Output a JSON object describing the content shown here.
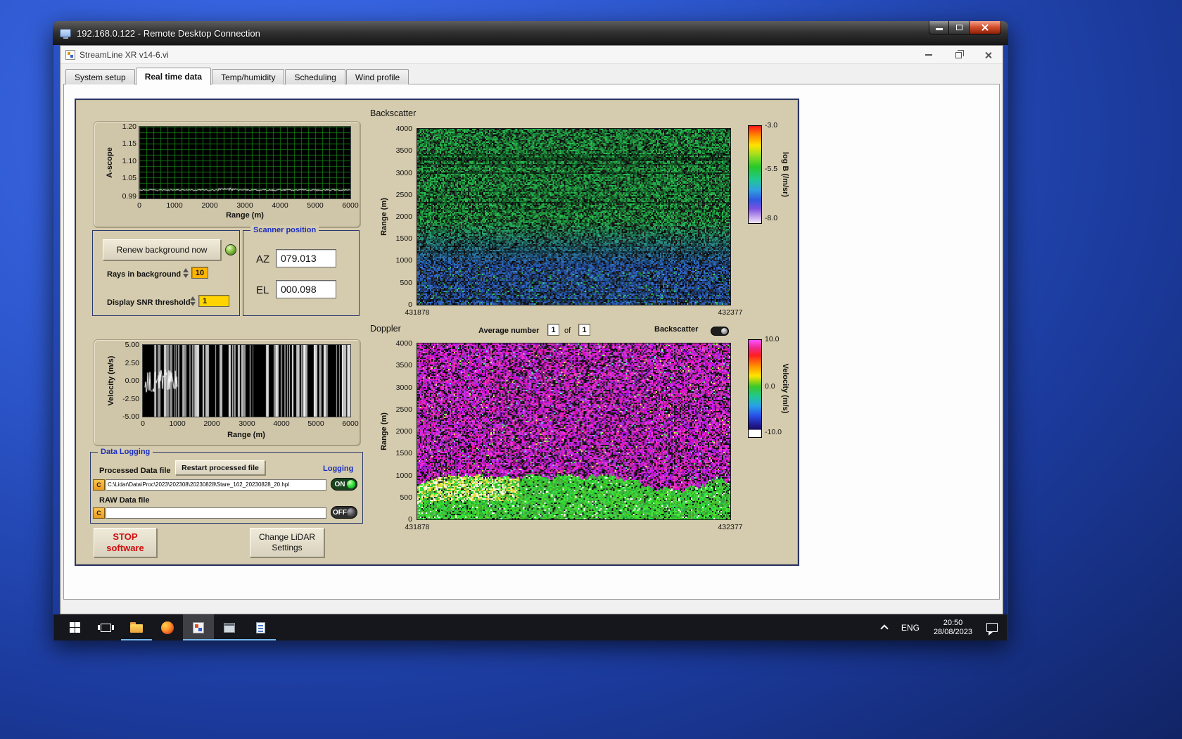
{
  "rdp": {
    "title": "192.168.0.122 - Remote Desktop Connection"
  },
  "app": {
    "title": "StreamLine XR v14-6.vi",
    "tabs": [
      "System setup",
      "Real time data",
      "Temp/humidity",
      "Scheduling",
      "Wind profile"
    ],
    "active_tab": "Real time data"
  },
  "ascope": {
    "ylabel": "A-scope",
    "xlabel": "Range (m)",
    "yticks": [
      "1.20",
      "1.15",
      "1.10",
      "1.05",
      "0.99"
    ],
    "xticks": [
      "0",
      "1000",
      "2000",
      "3000",
      "4000",
      "5000",
      "6000"
    ]
  },
  "background_controls": {
    "renew_button": "Renew background now",
    "rays_label": "Rays in background",
    "rays_value": "10",
    "snr_label": "Display SNR threshold",
    "snr_value": "1"
  },
  "scanner": {
    "title": "Scanner position",
    "az_label": "AZ",
    "az_value": "079.013",
    "el_label": "EL",
    "el_value": "000.098"
  },
  "backscatter": {
    "title": "Backscatter",
    "ylabel": "Range (m)",
    "yticks": [
      "4000",
      "3500",
      "3000",
      "2500",
      "2000",
      "1500",
      "1000",
      "500",
      "0"
    ],
    "x_start": "431878",
    "x_end": "432377",
    "colorbar": {
      "ticks": [
        "-3.0",
        "-5.5",
        "-8.0"
      ],
      "label": "log B (/m/sr)"
    }
  },
  "doppler": {
    "title": "Doppler",
    "average_label": "Average number",
    "average_value": "1",
    "of_label": "of",
    "of_value": "1",
    "backscatter_toggle_label": "Backscatter",
    "ylabel": "Range (m)",
    "yticks": [
      "4000",
      "3500",
      "3000",
      "2500",
      "2000",
      "1500",
      "1000",
      "500",
      "0"
    ],
    "x_start": "431878",
    "x_end": "432377",
    "colorbar": {
      "ticks": [
        "10.0",
        "0.0",
        "-10.0"
      ],
      "label": "Velocity (m/s)"
    }
  },
  "velocity": {
    "ylabel": "Velocity (m/s)",
    "xlabel": "Range (m)",
    "yticks": [
      "5.00",
      "2.50",
      "0.00",
      "-2.50",
      "-5.00"
    ],
    "xticks": [
      "0",
      "1000",
      "2000",
      "3000",
      "4000",
      "5000",
      "6000"
    ]
  },
  "data_logging": {
    "title": "Data Logging",
    "processed_label": "Processed Data file",
    "restart_button": "Restart processed file",
    "logging_label": "Logging",
    "processed_drive": "C",
    "processed_path": "C:\\Lidar\\Data\\Proc\\2023\\202308\\20230828\\Stare_162_20230828_20.hpl",
    "on_label": "ON",
    "raw_label": "RAW Data file",
    "raw_drive": "C",
    "raw_path": "",
    "off_label": "OFF"
  },
  "actions": {
    "stop_button": "STOP\nsoftware",
    "change_button": "Change LiDAR\nSettings"
  },
  "taskbar": {
    "language": "ENG",
    "time": "20:50",
    "date": "28/08/2023"
  },
  "chart_data": [
    {
      "type": "line",
      "title": "A-scope",
      "xlabel": "Range (m)",
      "ylabel": "A-scope",
      "xlim": [
        0,
        6000
      ],
      "yticks": [
        1.2,
        1.15,
        1.1,
        1.05,
        0.99
      ],
      "series": [
        {
          "name": "background",
          "description": "flat noisy trace at ~0.99 across 0-6000 m"
        }
      ]
    },
    {
      "type": "heatmap",
      "title": "Backscatter",
      "ylabel": "Range (m)",
      "xlim": [
        431878,
        432377
      ],
      "ylim": [
        0,
        4000
      ],
      "colorbar_label": "log B (/m/sr)",
      "colorbar_range": [
        -8.0,
        -3.0
      ],
      "description": "speckled green backscatter (~-5.5) above ~1500 m fading to blue (~-7) near the surface, with thin dark horizontal streaks"
    },
    {
      "type": "line",
      "title": "Doppler velocity profile",
      "xlabel": "Range (m)",
      "ylabel": "Velocity (m/s)",
      "xlim": [
        0,
        6000
      ],
      "ylim": [
        -5,
        5
      ],
      "description": "dense full-scale noise beyond ~500 m; coherent small-amplitude trace near range 0"
    },
    {
      "type": "heatmap",
      "title": "Doppler",
      "ylabel": "Range (m)",
      "xlim": [
        431878,
        432377
      ],
      "ylim": [
        0,
        4000
      ],
      "colorbar_label": "Velocity (m/s)",
      "colorbar_range": [
        -10,
        10
      ],
      "description": "magenta/black velocity noise aloft; coherent green/yellow velocities below ~700 m with bright patch at left"
    }
  ]
}
